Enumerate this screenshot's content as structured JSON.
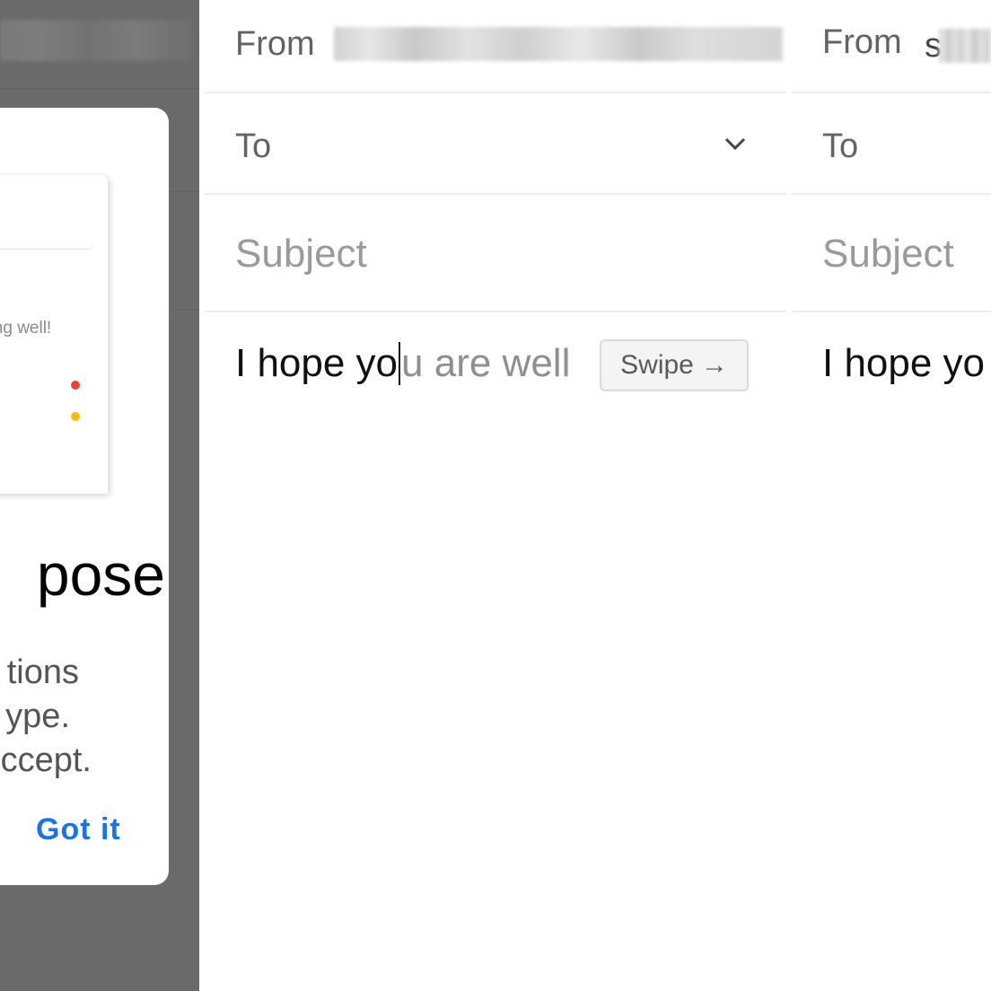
{
  "onboarding": {
    "illustration_text": "ping well!",
    "title": "pose",
    "description": [
      "tions",
      "ype.",
      "ccept."
    ],
    "got_it_label": "Got it",
    "dot_colors": [
      "#ea4335",
      "#fbbc04"
    ]
  },
  "compose_left": {
    "from_label": "From",
    "to_label": "To",
    "subject_placeholder": "Subject",
    "body_typed": "I hope yo",
    "body_suggestion": "u are well",
    "swipe_chip_label": "Swipe",
    "swipe_arrow": "→"
  },
  "compose_right": {
    "from_label": "From",
    "from_visible_char": "s",
    "to_label": "To",
    "subject_placeholder": "Subject",
    "body_typed": "I hope yo"
  },
  "colors": {
    "accent": "#1a73e8",
    "dim_overlay": "#6a6a6a"
  }
}
